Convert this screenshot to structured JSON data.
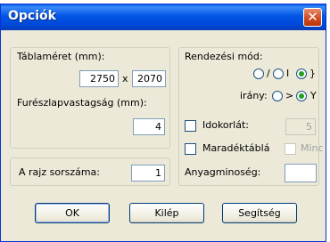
{
  "window": {
    "title": "Opciók",
    "close_glyph": "✕"
  },
  "board": {
    "size_label": "Táblaméret (mm):",
    "width": "2750",
    "times": "x",
    "height": "2070",
    "kerf_label": "Furészlapvastagság (mm):",
    "kerf": "4"
  },
  "drawing": {
    "label": "A rajz sorszáma:",
    "value": "1"
  },
  "sort": {
    "label": "Rendezési mód:",
    "mode_options": [
      "/",
      "I",
      "}"
    ],
    "mode_selected": 2,
    "direction_label": "irány:",
    "direction_options": [
      ">",
      "Y"
    ],
    "direction_selected": 1
  },
  "timelimit": {
    "label": "Idokorlát:",
    "value": "5",
    "checked": false
  },
  "remainder": {
    "label": "Maradéktáblá",
    "min_label": "Minc",
    "checked": false
  },
  "material": {
    "label": "Anyagminoség:",
    "value": ""
  },
  "buttons": {
    "ok": "OK",
    "exit": "Kilép",
    "help": "Segítség"
  }
}
